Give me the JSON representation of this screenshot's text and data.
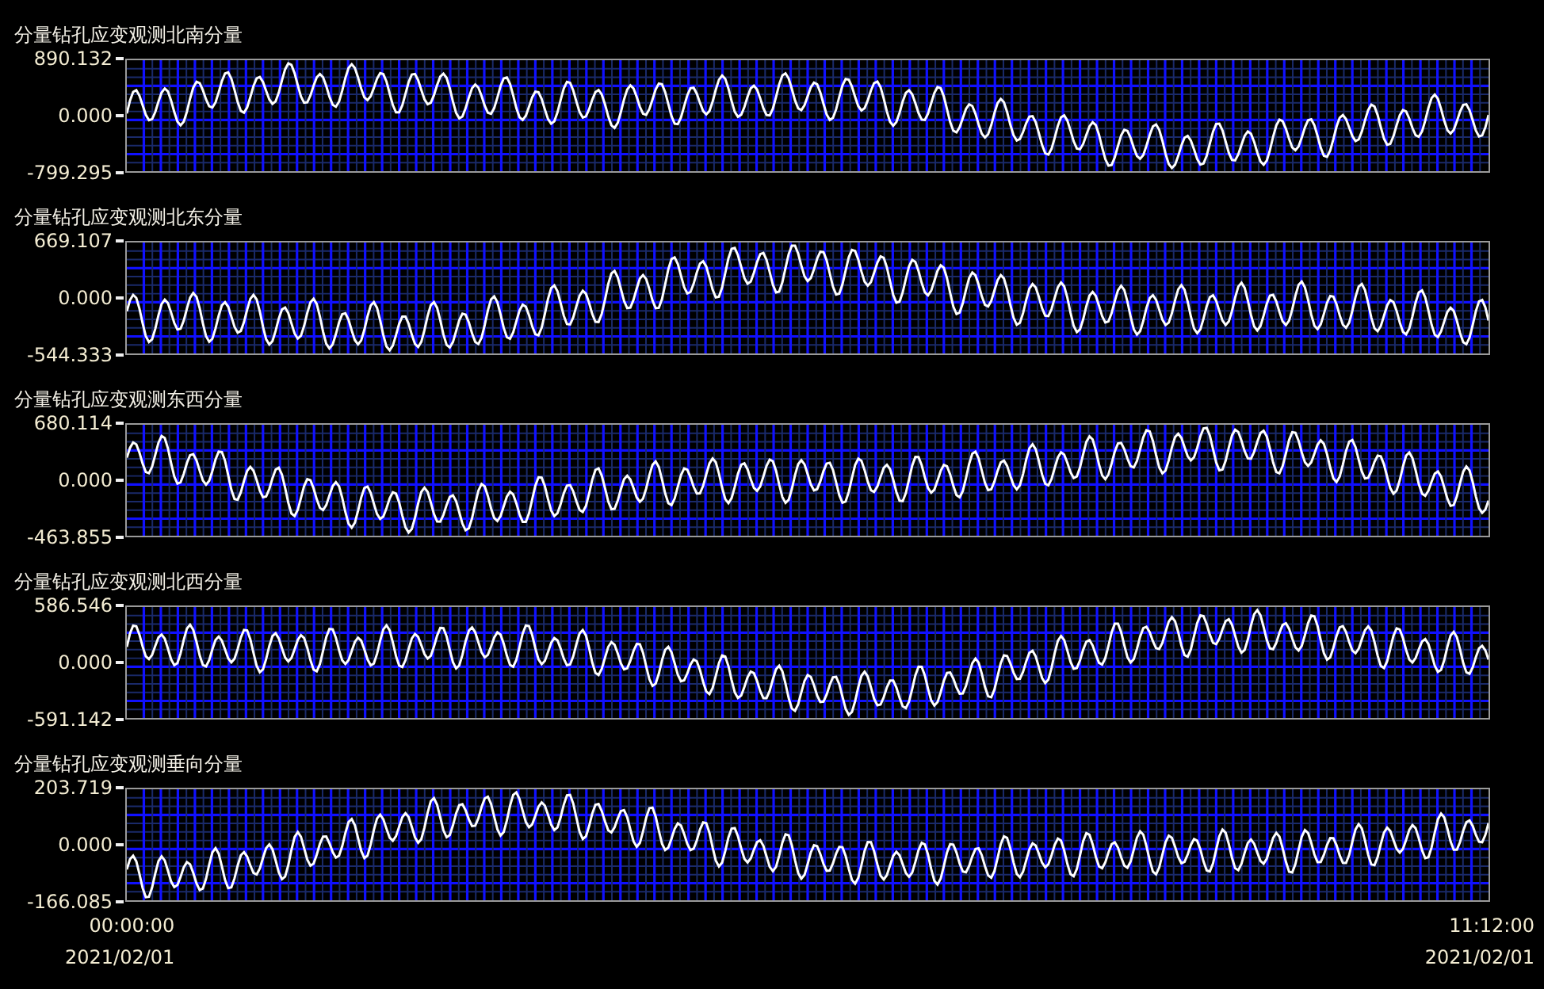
{
  "charts": [
    {
      "title": "分量钻孔应变观测北南分量",
      "y_max": "890.132",
      "y_zero": "0.000",
      "y_min": "-799.295"
    },
    {
      "title": "分量钻孔应变观测北东分量",
      "y_max": "669.107",
      "y_zero": "0.000",
      "y_min": "-544.333"
    },
    {
      "title": "分量钻孔应变观测东西分量",
      "y_max": "680.114",
      "y_zero": "0.000",
      "y_min": "-463.855"
    },
    {
      "title": "分量钻孔应变观测北西分量",
      "y_max": "586.546",
      "y_zero": "0.000",
      "y_min": "-591.142"
    },
    {
      "title": "分量钻孔应变观测垂向分量",
      "y_max": "203.719",
      "y_zero": "0.000",
      "y_min": "-166.085"
    }
  ],
  "x_axis": {
    "start_time": "00:00:00",
    "start_date": "2021/02/01",
    "end_time": "11:12:00",
    "end_date": "2021/02/01"
  }
}
